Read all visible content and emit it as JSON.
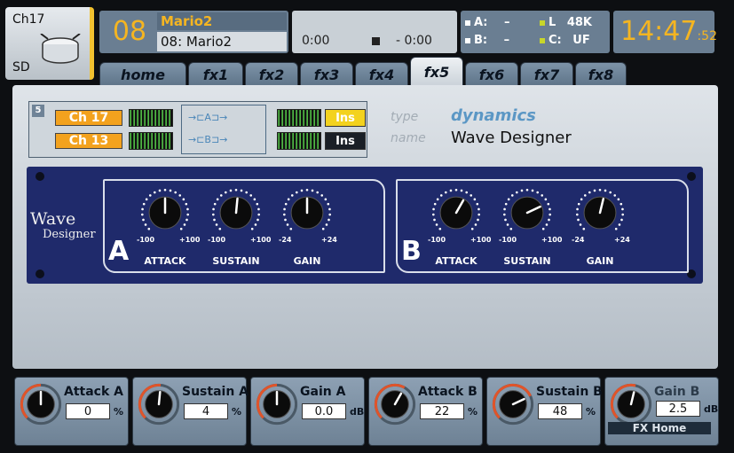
{
  "channel": {
    "number": "Ch17",
    "short": "SD"
  },
  "show": {
    "number": "08",
    "name": "Mario2",
    "scene": "08: Mario2"
  },
  "transport": {
    "time1": "0:00",
    "time2": "- 0:00"
  },
  "status": {
    "a_label": "A:",
    "a_value": "–",
    "b_label": "B:",
    "b_value": "–",
    "l_label": "L",
    "l_value": "48K",
    "c_label": "C:",
    "c_value": "UF"
  },
  "clock": {
    "hm": "14:47",
    "sec": ":52"
  },
  "tabs": [
    "home",
    "fx1",
    "fx2",
    "fx3",
    "fx4",
    "fx5",
    "fx6",
    "fx7",
    "fx8"
  ],
  "active_tab": "fx5",
  "rack": {
    "slot": "5",
    "in_a": "Ch 17",
    "in_b": "Ch 13",
    "route_a": "→⊏A⊐→",
    "route_b": "→⊏B⊐→",
    "ins_a": "Ins",
    "ins_b": "Ins",
    "type_label": "type",
    "type_value": "dynamics",
    "name_label": "name",
    "name_value": "Wave Designer"
  },
  "plugin": {
    "logo_line1": "Wave",
    "logo_line2": "Designer",
    "sections": [
      {
        "letter": "A",
        "knobs": [
          {
            "label": "ATTACK",
            "min": "-100",
            "max": "+100",
            "level": 0.5
          },
          {
            "label": "SUSTAIN",
            "min": "-100",
            "max": "+100",
            "level": 0.52
          },
          {
            "label": "GAIN",
            "min": "-24",
            "max": "+24",
            "level": 0.5
          }
        ]
      },
      {
        "letter": "B",
        "knobs": [
          {
            "label": "ATTACK",
            "min": "-100",
            "max": "+100",
            "level": 0.61
          },
          {
            "label": "SUSTAIN",
            "min": "-100",
            "max": "+100",
            "level": 0.74
          },
          {
            "label": "GAIN",
            "min": "-24",
            "max": "+24",
            "level": 0.55
          }
        ]
      }
    ]
  },
  "bottom": [
    {
      "name": "Attack A",
      "value": "0",
      "unit": "%",
      "level": 0.5
    },
    {
      "name": "Sustain A",
      "value": "4",
      "unit": "%",
      "level": 0.52
    },
    {
      "name": "Gain A",
      "value": "0.0",
      "unit": "dB",
      "level": 0.5
    },
    {
      "name": "Attack B",
      "value": "22",
      "unit": "%",
      "level": 0.61
    },
    {
      "name": "Sustain B",
      "value": "48",
      "unit": "%",
      "level": 0.74
    },
    {
      "name": "Gain B",
      "value": "2.5",
      "unit": "dB",
      "level": 0.55
    }
  ],
  "fx_home": "FX Home",
  "colors": {
    "accent": "#f5b521",
    "ins_on": "#f3d21e",
    "ins_off": "#1a1f26",
    "ring": "#e0542a"
  }
}
